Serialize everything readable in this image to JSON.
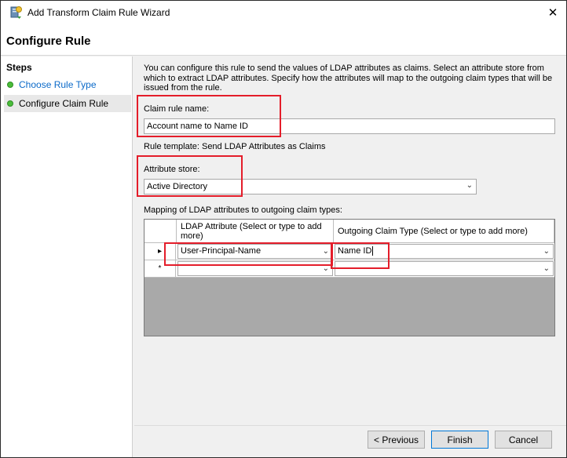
{
  "window": {
    "title": "Add Transform Claim Rule Wizard",
    "close_glyph": "✕"
  },
  "header": {
    "title": "Configure Rule"
  },
  "sidebar": {
    "heading": "Steps",
    "items": [
      {
        "label": "Choose Rule Type",
        "state": "completed-link"
      },
      {
        "label": "Configure Claim Rule",
        "state": "current"
      }
    ]
  },
  "main": {
    "description": "You can configure this rule to send the values of LDAP attributes as claims. Select an attribute store from which to extract LDAP attributes. Specify how the attributes will map to the outgoing claim types that will be issued from the rule.",
    "claim_rule_name_label": "Claim rule name:",
    "claim_rule_name_value": "Account name to Name ID",
    "rule_template": "Rule template: Send LDAP Attributes as Claims",
    "attribute_store_label": "Attribute store:",
    "attribute_store_value": "Active Directory",
    "mapping_label": "Mapping of LDAP attributes to outgoing claim types:",
    "grid": {
      "columns": [
        "LDAP Attribute (Select or type to add more)",
        "Outgoing Claim Type (Select or type to add more)"
      ],
      "rows": [
        {
          "marker": "▸",
          "ldap": "User-Principal-Name",
          "claim": "Name ID"
        },
        {
          "marker": "*",
          "ldap": "",
          "claim": ""
        }
      ]
    }
  },
  "footer": {
    "previous_label": "< Previous",
    "finish_label": "Finish",
    "cancel_label": "Cancel"
  },
  "colors": {
    "highlight_box": "#e41d2a",
    "step_dot": "#4bbd3a",
    "link": "#0b6ac9"
  }
}
